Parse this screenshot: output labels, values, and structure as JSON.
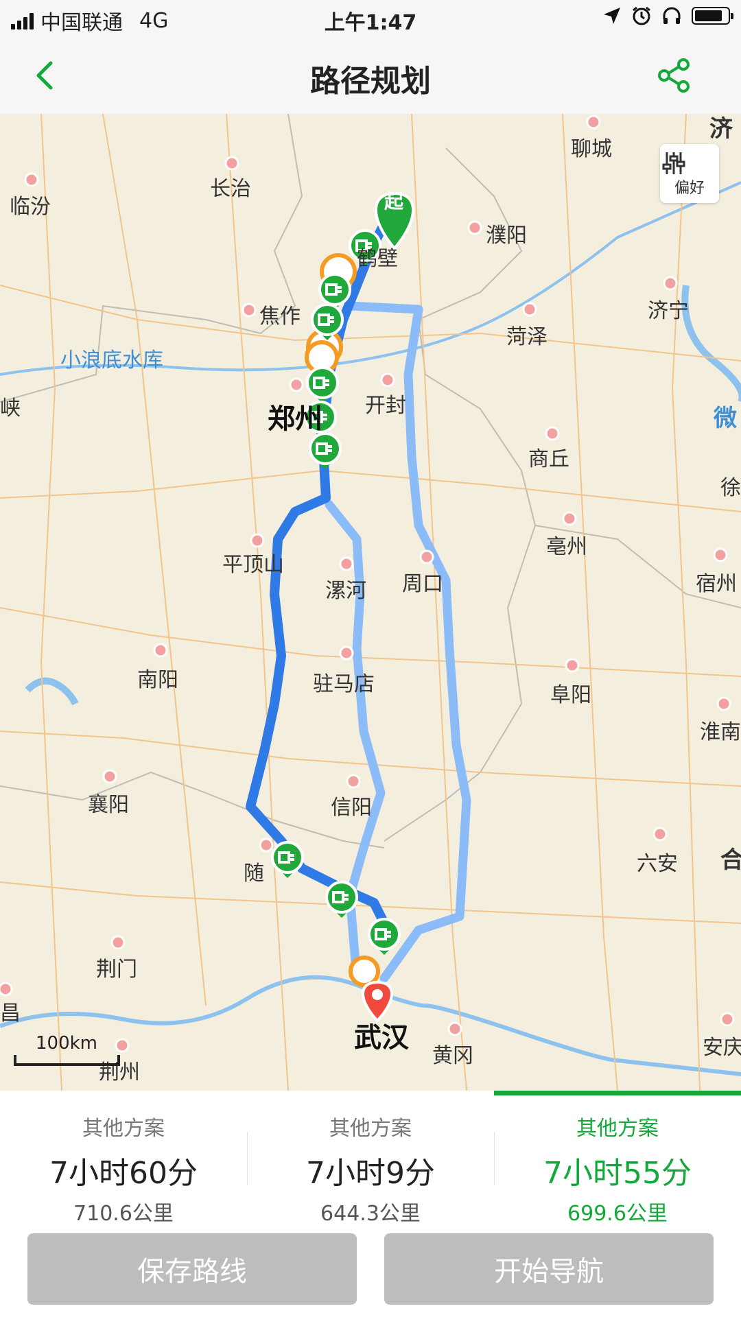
{
  "status_bar": {
    "carrier": "中国联通",
    "network": "4G",
    "time": "上午1:47",
    "battery_level": 0.85
  },
  "nav": {
    "title": "路径规划",
    "back_icon": "chevron-left-icon",
    "share_icon": "share-icon"
  },
  "map": {
    "preference_label": "偏好",
    "start_marker_label": "起",
    "scale_label": "100km",
    "cities": [
      "济",
      "聊城",
      "长治",
      "临汾",
      "濮阳",
      "鹤壁",
      "焦作",
      "济宁",
      "菏泽",
      "小浪底水库",
      "峡",
      "郑州",
      "开封",
      "微",
      "商丘",
      "徐",
      "平顶山",
      "漯河",
      "周口",
      "亳州",
      "宿州",
      "南阳",
      "驻马店",
      "阜阳",
      "淮南",
      "襄阳",
      "信阳",
      "六安",
      "合",
      "随",
      "荆门",
      "武汉",
      "黄冈",
      "安庆",
      "昌",
      "荆州"
    ]
  },
  "route_options": [
    {
      "label": "其他方案",
      "time": "7小时60分",
      "distance": "710.6公里",
      "active": false
    },
    {
      "label": "其他方案",
      "time": "7小时9分",
      "distance": "644.3公里",
      "active": false
    },
    {
      "label": "其他方案",
      "time": "7小时55分",
      "distance": "699.6公里",
      "active": true
    }
  ],
  "actions": {
    "save": "保存路线",
    "start": "开始导航"
  },
  "colors": {
    "accent": "#14a83b",
    "route_primary": "#2f7ae5",
    "route_alt": "#8cbcf7",
    "charger_green": "#21a83a",
    "charger_orange": "#f59a22",
    "destination": "#f04a3f"
  }
}
